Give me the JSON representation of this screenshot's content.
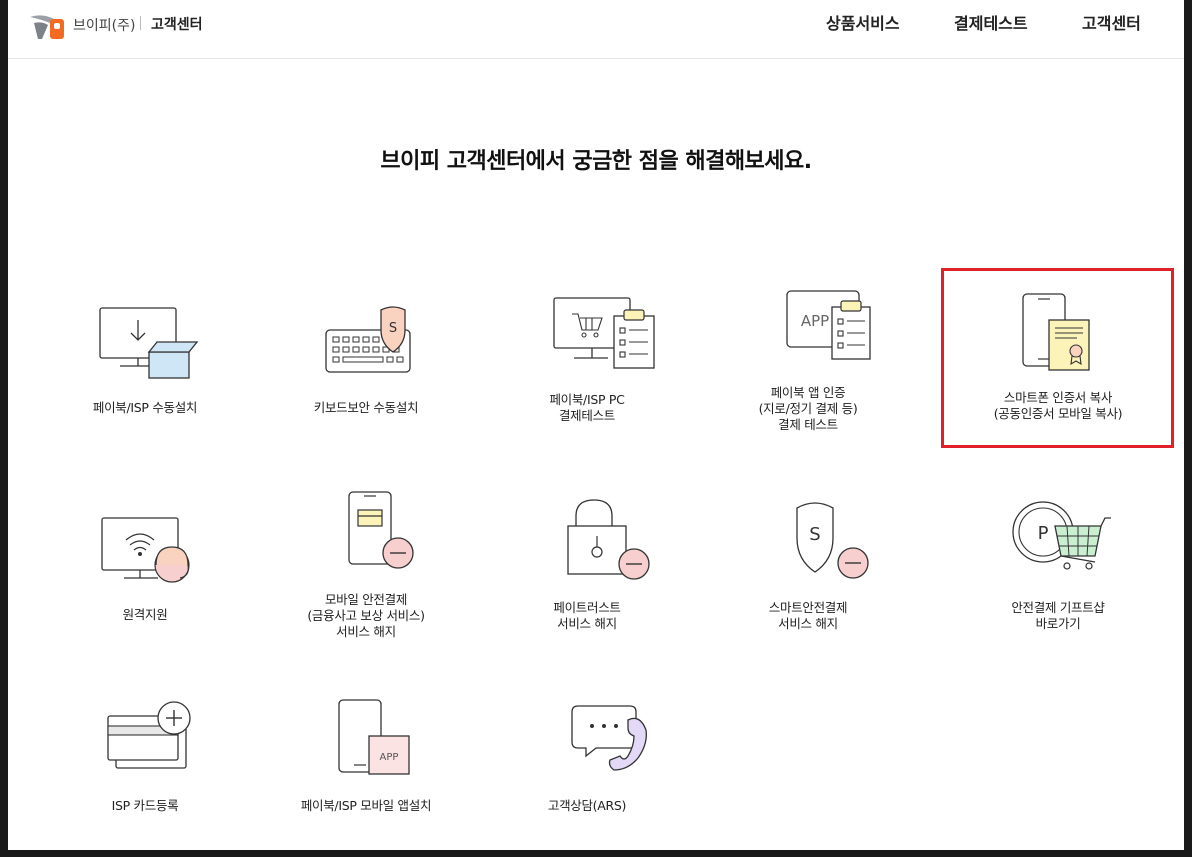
{
  "header": {
    "brand_name": "브이피(주)",
    "center_title": "고객센터",
    "nav": [
      {
        "label": "상품서비스"
      },
      {
        "label": "결제테스트"
      },
      {
        "label": "고객센터"
      }
    ]
  },
  "main": {
    "headline": "브이피 고객센터에서 궁금한 점을 해결해보세요.",
    "tiles": [
      {
        "lines": [
          "페이북/ISP 수동설치"
        ],
        "icon": "monitor-download-icon"
      },
      {
        "lines": [
          "키보드보안 수동설치"
        ],
        "icon": "keyboard-shield-icon"
      },
      {
        "lines": [
          "페이북/ISP PC",
          "결제테스트"
        ],
        "icon": "monitor-cart-checklist-icon"
      },
      {
        "lines": [
          "페이북 앱 인증",
          "(지로/정기 결제 등)",
          "결제 테스트"
        ],
        "icon": "app-checklist-icon"
      },
      {
        "lines": [
          "스마트폰 인증서 복사",
          "(공동인증서 모바일 복사)"
        ],
        "icon": "phone-certificate-icon"
      },
      {
        "lines": [
          "원격지원"
        ],
        "icon": "monitor-wifi-agent-icon"
      },
      {
        "lines": [
          "모바일 안전결제",
          "(금융사고 보상 서비스)",
          "서비스 해지"
        ],
        "icon": "phone-card-minus-icon"
      },
      {
        "lines": [
          "페이트러스트",
          "서비스 해지"
        ],
        "icon": "lock-minus-icon"
      },
      {
        "lines": [
          "스마트안전결제",
          "서비스 해지"
        ],
        "icon": "shield-minus-icon"
      },
      {
        "lines": [
          "안전결제 기프트샵",
          "바로가기"
        ],
        "icon": "coin-cart-icon"
      },
      {
        "lines": [
          "ISP 카드등록"
        ],
        "icon": "card-plus-icon"
      },
      {
        "lines": [
          "페이북/ISP 모바일 앱설치"
        ],
        "icon": "phone-app-icon"
      },
      {
        "lines": [
          "고객상담(ARS)"
        ],
        "icon": "chat-phone-icon"
      }
    ]
  },
  "colors": {
    "accent_peach": "#f9d3bf",
    "accent_blue": "#cfe6f7",
    "accent_yellow": "#fbf3b8",
    "accent_pink": "#f7cfcf",
    "accent_green": "#c9efd0",
    "highlight_red": "#e0212b"
  }
}
